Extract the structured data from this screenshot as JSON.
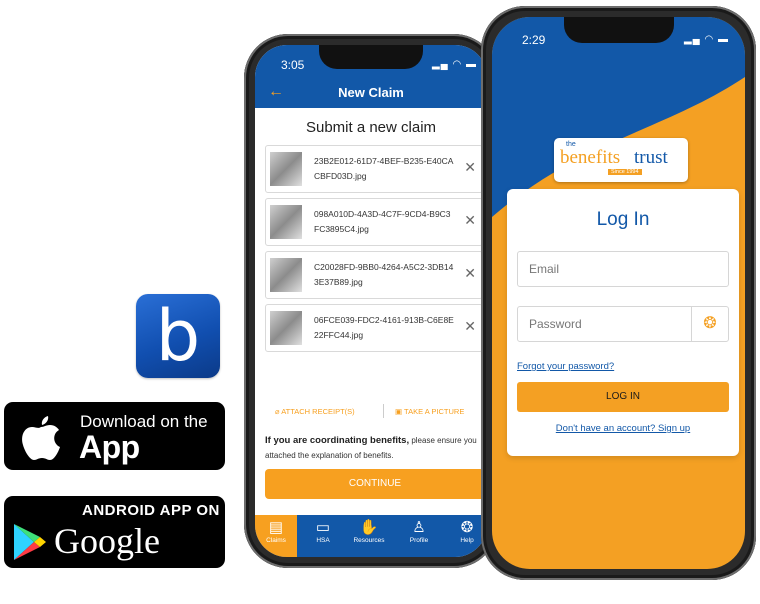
{
  "colors": {
    "brand_blue": "#1258a8",
    "brand_orange": "#f7a020"
  },
  "app_icon": {
    "letter": "b"
  },
  "appstore_badge": {
    "line1": "Download on the",
    "line2": "App Store"
  },
  "googleplay_badge": {
    "line1": "ANDROID APP ON",
    "line2": "Google play"
  },
  "phone1": {
    "status_time": "3:05",
    "header_title": "New Claim",
    "subtitle": "Submit a new claim",
    "receipts": [
      {
        "name": "23B2E012-61D7-4BEF-B235-E40CACBFD03D.jpg"
      },
      {
        "name": "098A010D-4A3D-4C7F-9CD4-B9C3FC3895C4.jpg"
      },
      {
        "name": "C20028FD-9BB0-4264-A5C2-3DB143E37B89.jpg"
      },
      {
        "name": "06FCE039-FDC2-4161-913B-C6E8E22FFC44.jpg"
      }
    ],
    "attach_label": "ATTACH RECEIPT(S)",
    "picture_label": "TAKE A PICTURE",
    "coord_bold": "If you are coordinating benefits,",
    "coord_text": " please ensure you attached the explanation of benefits.",
    "continue_label": "CONTINUE",
    "tabs": [
      {
        "label": "Claims",
        "icon": "claims-icon"
      },
      {
        "label": "HSA",
        "icon": "wallet-icon"
      },
      {
        "label": "Resources",
        "icon": "hand-icon"
      },
      {
        "label": "Profile",
        "icon": "person-icon"
      },
      {
        "label": "Help",
        "icon": "lifebuoy-icon"
      }
    ]
  },
  "phone2": {
    "status_time": "2:29",
    "logo": {
      "the": "the",
      "benefits": "benefits",
      "trust": "trust",
      "since": "Since 1994"
    },
    "login_title": "Log In",
    "email_placeholder": "Email",
    "password_placeholder": "Password",
    "forgot_label": "Forgot your password?",
    "login_button": "LOG IN",
    "signup_label": "Don't have an account? Sign up"
  }
}
